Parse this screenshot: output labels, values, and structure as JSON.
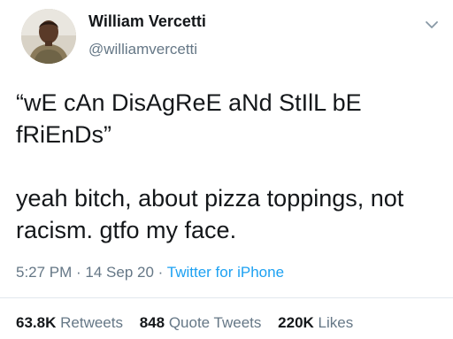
{
  "tweet": {
    "author_name": "William Vercetti",
    "author_handle": "@williamvercetti",
    "text_line_1": "“wE cAn DisAgReE aNd StIlL bE fRiEnDs”",
    "text_line_2": "yeah bitch, about pizza toppings, not racism. gtfo my face.",
    "time": "5:27 PM",
    "separator": " · ",
    "date": "14 Sep 20",
    "source": "Twitter for iPhone"
  },
  "stats": {
    "retweets_count": "63.8K",
    "retweets_label": "Retweets",
    "quotes_count": "848",
    "quotes_label": "Quote Tweets",
    "likes_count": "220K",
    "likes_label": "Likes"
  },
  "icons": {
    "avatar": "profile-photo",
    "menu": "chevron-down-icon"
  },
  "colors": {
    "text": "#14171a",
    "secondary": "#657786",
    "link": "#1da1f2",
    "divider": "#e1e8ed"
  }
}
